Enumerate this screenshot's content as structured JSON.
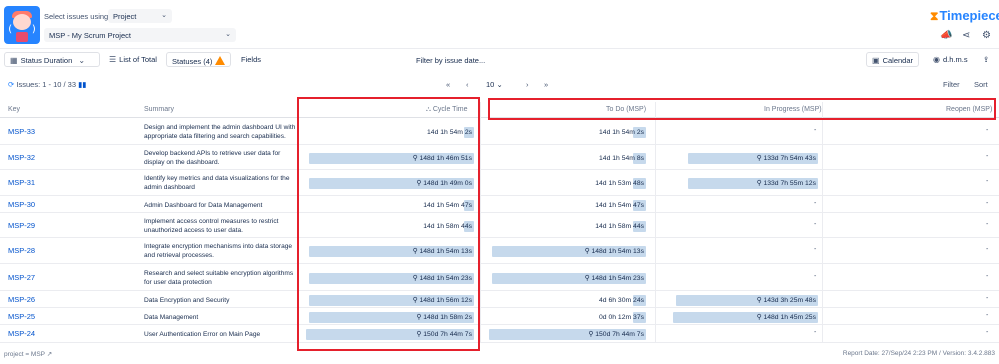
{
  "header": {
    "select_label": "Select issues using",
    "select_value": "Project",
    "project_value": "MSP - My Scrum Project",
    "brand_name": "Timepiece",
    "brand_color": "#2684ff",
    "top_icons": [
      "announce-icon",
      "share-icon",
      "settings-icon"
    ]
  },
  "toolbar": {
    "status_duration": "Status Duration",
    "list_of_total": "List of Total",
    "statuses": "Statuses (4)",
    "fields": "Fields",
    "filter_by_date": "Filter by issue date...",
    "calendar": "Calendar",
    "dhms": "d.h.m.s"
  },
  "pager": {
    "issues_text": "Issues: 1 - 10 / 33",
    "first": "«",
    "prev": "‹",
    "page_size": "10",
    "next": "›",
    "last": "»",
    "filter": "Filter",
    "sort": "Sort"
  },
  "table": {
    "columns": {
      "key": "Key",
      "summary": "Summary",
      "cycle_time": "Cycle Time",
      "todo": "To Do (MSP)",
      "in_progress": "In Progress (MSP)",
      "reopen": "Reopen (MSP)"
    },
    "rows": [
      {
        "key": "MSP-33",
        "summary": "Design and implement the admin dashboard UI with appropriate data filtering and search capabilities.",
        "cycle": "14d 1h 54m 2s",
        "cycle_frac": 0.04,
        "todo": "14d 1h 54m 2s",
        "todo_frac": 0.04,
        "inprog": "-",
        "inprog_frac": 0,
        "reopen": "-"
      },
      {
        "key": "MSP-32",
        "summary": "Develop backend APIs to retrieve user data for display on the dashboard.",
        "cycle": "148d 1h 46m 51s",
        "cycle_frac": 0.98,
        "todo": "14d 1h 54m 8s",
        "todo_frac": 0.04,
        "inprog": "133d 7h 54m 43s",
        "inprog_frac": 0.82,
        "reopen": "-"
      },
      {
        "key": "MSP-31",
        "summary": "Identify key metrics and data visualizations for the admin dashboard",
        "cycle": "148d 1h 49m 0s",
        "cycle_frac": 0.98,
        "todo": "14d 1h 53m 48s",
        "todo_frac": 0.04,
        "inprog": "133d 7h 55m 12s",
        "inprog_frac": 0.82,
        "reopen": "-"
      },
      {
        "key": "MSP-30",
        "summary": "Admin Dashboard for Data Management",
        "cycle": "14d 1h 54m 47s",
        "cycle_frac": 0.04,
        "todo": "14d 1h 54m 47s",
        "todo_frac": 0.04,
        "inprog": "-",
        "inprog_frac": 0,
        "reopen": "-"
      },
      {
        "key": "MSP-29",
        "summary": "Implement access control measures to restrict unauthorized access to user data.",
        "cycle": "14d 1h 58m 44s",
        "cycle_frac": 0.04,
        "todo": "14d 1h 58m 44s",
        "todo_frac": 0.04,
        "inprog": "-",
        "inprog_frac": 0,
        "reopen": "-"
      },
      {
        "key": "MSP-28",
        "summary": "Integrate encryption mechanisms into data storage and retrieval processes.",
        "cycle": "148d 1h 54m 13s",
        "cycle_frac": 0.98,
        "todo": "148d 1h 54m 13s",
        "todo_frac": 0.95,
        "inprog": "-",
        "inprog_frac": 0,
        "reopen": "-"
      },
      {
        "key": "MSP-27",
        "summary": "Research and select suitable encryption algorithms for user data protection",
        "cycle": "148d 1h 54m 23s",
        "cycle_frac": 0.98,
        "todo": "148d 1h 54m 23s",
        "todo_frac": 0.95,
        "inprog": "-",
        "inprog_frac": 0,
        "reopen": "-"
      },
      {
        "key": "MSP-26",
        "summary": "Data Encryption and Security",
        "cycle": "148d 1h 56m 12s",
        "cycle_frac": 0.98,
        "todo": "4d 6h 30m 24s",
        "todo_frac": 0.02,
        "inprog": "143d 3h 25m 48s",
        "inprog_frac": 0.9,
        "reopen": "-"
      },
      {
        "key": "MSP-25",
        "summary": "Data Management",
        "cycle": "148d 1h 58m 2s",
        "cycle_frac": 0.98,
        "todo": "0d 0h 12m 37s",
        "todo_frac": 0,
        "inprog": "148d 1h 45m 25s",
        "inprog_frac": 0.92,
        "reopen": "-"
      },
      {
        "key": "MSP-24",
        "summary": "User Authentication Error on Main Page",
        "cycle": "150d 7h 44m 7s",
        "cycle_frac": 1.0,
        "todo": "150d 7h 44m 7s",
        "todo_frac": 0.97,
        "inprog": "-",
        "inprog_frac": 0,
        "reopen": "-"
      }
    ]
  },
  "footer": {
    "jql": "project = MSP",
    "report": "Report Date: 27/Sep/24 2:23 PM / Version: 3.4.2.883"
  },
  "colors": {
    "bar": "#c6d9ec",
    "highlight": "#e5202c",
    "link": "#0052cc"
  }
}
